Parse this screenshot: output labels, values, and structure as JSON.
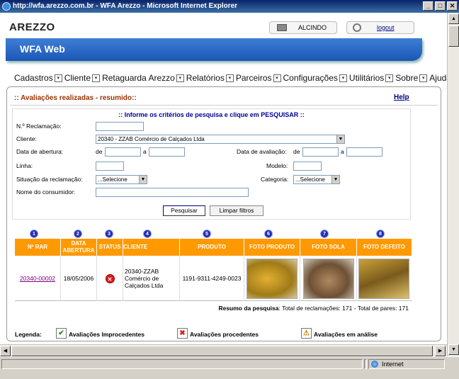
{
  "window": {
    "title": "http://wfa.arezzo.com.br - WFA Arezzo - Microsoft Internet Explorer",
    "buttons": [
      "_",
      "□",
      "✕"
    ]
  },
  "header": {
    "logo": "AREZZO",
    "user": "ALCINDO",
    "logout": "logout",
    "banner": "WFA Web"
  },
  "menu": [
    "Cadastros",
    "Cliente",
    "Retaguarda Arezzo",
    "Relatórios",
    "Parceiros",
    "Configurações",
    "Utilitários",
    "Sobre",
    "Ajuda"
  ],
  "page": {
    "title": ":: Avaliações realizadas - resumido::",
    "help": "Help"
  },
  "form": {
    "header": ":: Informe os critérios de pesquisa e clique em PESQUISAR ::",
    "labels": {
      "reclamacao": "N.º Reclamação:",
      "cliente": "Cliente:",
      "abertura": "Data de abertura:",
      "de1": "de",
      "a1": "a",
      "avaliacao": "Data de avaliação:",
      "de2": "de",
      "a2": "a",
      "linha": "Linha:",
      "modelo": "Modelo:",
      "situacao": "Situação da reclamação:",
      "categoria": "Categoria:",
      "consumidor": "Nome do consumidor:"
    },
    "cliente_value": "20340 - ZZAB Comércio de Calçados Ltda",
    "situacao_value": "...Selecione",
    "categoria_value": "...Selecione",
    "btn_pesquisar": "Pesquisar",
    "btn_limpar": "Limpar filtros"
  },
  "table": {
    "columns": [
      {
        "num": "1",
        "label": "Nº RAR"
      },
      {
        "num": "2",
        "label": "DATA ABERTURA"
      },
      {
        "num": "3",
        "label": "STATUS"
      },
      {
        "num": "4",
        "label": "CLIENTE"
      },
      {
        "num": "5",
        "label": "PRODUTO"
      },
      {
        "num": "6",
        "label": "FOTO PRODUTO"
      },
      {
        "num": "7",
        "label": "FOTO SOLA"
      },
      {
        "num": "8",
        "label": "FOTO DEFEITO"
      }
    ],
    "row": {
      "rar": "20340-00002",
      "data": "18/05/2006",
      "status_icon": "error-icon",
      "cliente": "20340-ZZAB Comércio de Calçados Ltda",
      "produto": "1191-9311-4249-0023"
    },
    "summary_label": "Resumo da pesquisa",
    "summary_text": ": Total de reclamações: 171 - Total de pares: 171"
  },
  "legend": {
    "label": "Legenda:",
    "improcedentes": "Avaliações Improcedentes",
    "procedentes": "Avaliações procedentes",
    "analise": "Avaliações em análise"
  },
  "statusbar": {
    "zone": "Internet"
  }
}
